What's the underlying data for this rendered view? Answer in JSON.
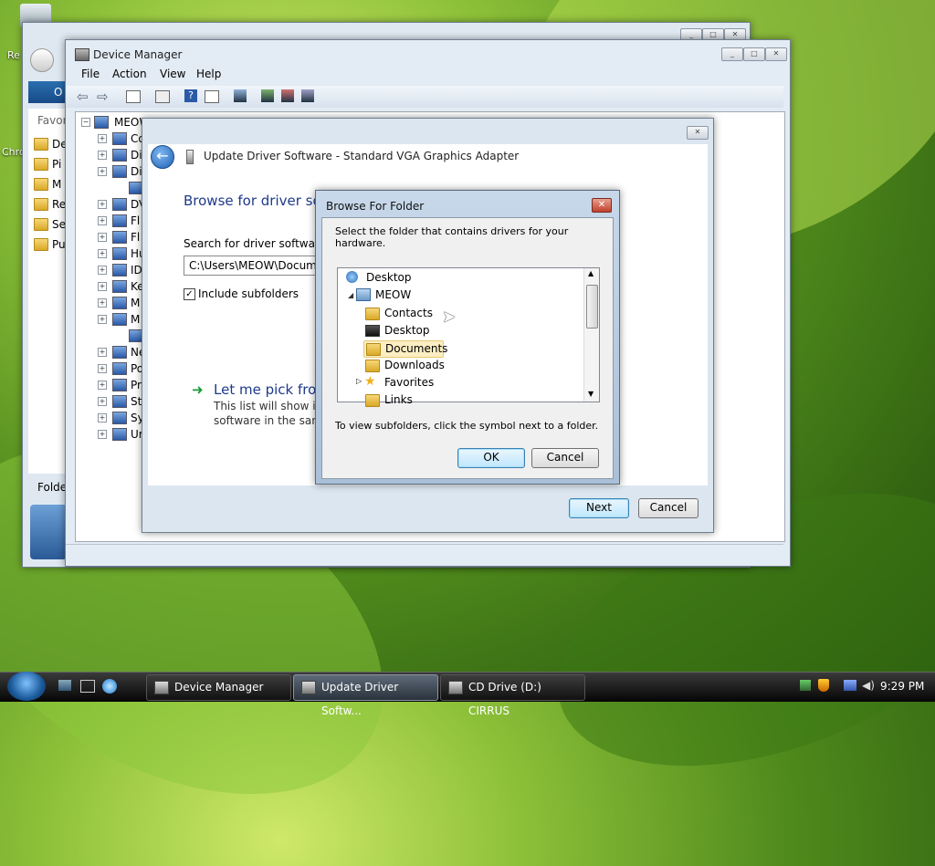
{
  "desktop": {
    "recycle_label": "Re",
    "chrome_label": "Chro"
  },
  "explorer": {
    "address_label": "O",
    "favorites_header": "Favor",
    "favorites": [
      "De",
      "Pi",
      "M",
      "Re",
      "Se",
      "Pu"
    ],
    "folders_label": "Folde"
  },
  "device_manager": {
    "title": "Device Manager",
    "menu": [
      "File",
      "Action",
      "View",
      "Help"
    ],
    "root": "MEOW",
    "tree": [
      "Co",
      "Di",
      "Di",
      "",
      "DV",
      "Fl",
      "Fl",
      "Hu",
      "ID",
      "Ke",
      "M",
      "M",
      "",
      "Ne",
      "Po",
      "Pr",
      "St",
      "Sy",
      "Ur"
    ]
  },
  "update_driver": {
    "title": "Update Driver Software - Standard VGA Graphics Adapter",
    "heading": "Browse for driver sof",
    "search_label": "Search for driver software in",
    "path_value": "C:\\Users\\MEOW\\Documen",
    "include_subfolders": "Include subfolders",
    "pick_title": "Let me pick from",
    "pick_desc_1": "This list will show inst",
    "pick_desc_2": "software in the same",
    "next": "Next",
    "cancel": "Cancel"
  },
  "browse_folder": {
    "title": "Browse For Folder",
    "instruction": "Select the folder that contains drivers for your hardware.",
    "tree": {
      "desktop": "Desktop",
      "user": "MEOW",
      "items": [
        "Contacts",
        "Desktop",
        "Documents",
        "Downloads",
        "Favorites",
        "Links"
      ],
      "selected": "Documents"
    },
    "hint": "To view subfolders, click the symbol next to a folder.",
    "ok": "OK",
    "cancel": "Cancel"
  },
  "taskbar": {
    "tasks": [
      "Device Manager",
      "Update Driver Softw...",
      "CD Drive (D:) CIRRUS"
    ],
    "time": "9:29 PM"
  },
  "colors": {
    "accent": "#3c7fb1",
    "heading_blue": "#1e3a8a",
    "link_green": "#1a7a1a",
    "selection": "#fbeec2"
  }
}
